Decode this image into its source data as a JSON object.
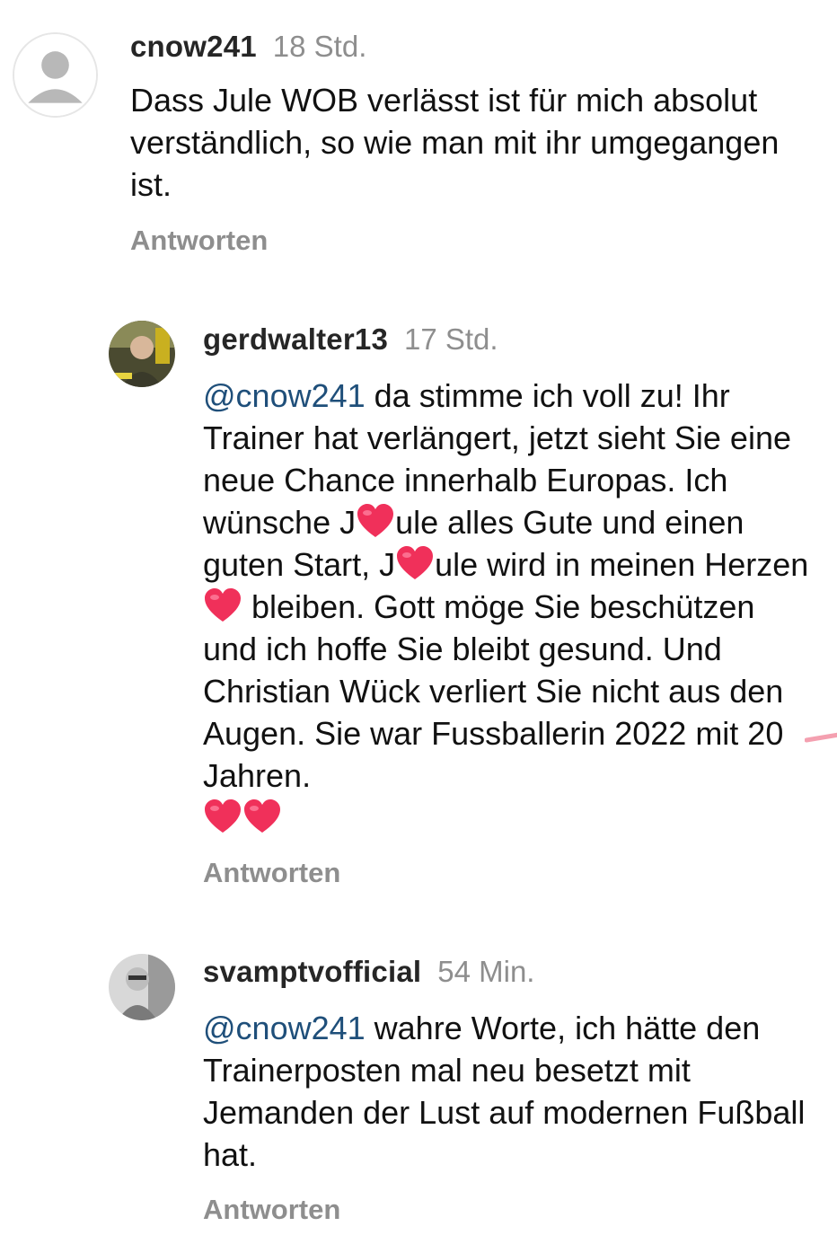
{
  "comments": [
    {
      "username": "cnow241",
      "time": "18 Std.",
      "text": "Dass Jule WOB verlässt ist für mich absolut verständlich, so wie man mit ihr umgegangen ist.",
      "reply_label": "Antworten",
      "avatar": "default-avatar-icon"
    },
    {
      "username": "gerdwalter13",
      "time": "17 Std.",
      "mention": "@cnow241",
      "text_parts": [
        " da stimme ich voll zu! Ihr Trainer hat verlängert,  jetzt sieht Sie eine neue Chance  innerhalb Europas. Ich wünsche J",
        "ule alles Gute und einen guten Start, J",
        "ule wird in meinen Herzen ",
        " bleiben. Gott möge Sie beschützen und ich hoffe Sie bleibt gesund. Und Christian Wück verliert Sie nicht aus den Augen. Sie war Fussballerin 2022 mit 20 Jahren."
      ],
      "reply_label": "Antworten",
      "avatar": "user-photo-avatar"
    },
    {
      "username": "svamptvofficial",
      "time": "54 Min.",
      "mention": "@cnow241",
      "text": " wahre Worte, ich hätte den Trainerposten mal neu besetzt mit Jemanden der Lust auf modernen Fußball hat.",
      "reply_label": "Antworten",
      "avatar": "user-photo-avatar"
    }
  ],
  "colors": {
    "username": "#262626",
    "time": "#8e8e8e",
    "mention": "#1f4f7a",
    "heart": "#f0305a"
  }
}
